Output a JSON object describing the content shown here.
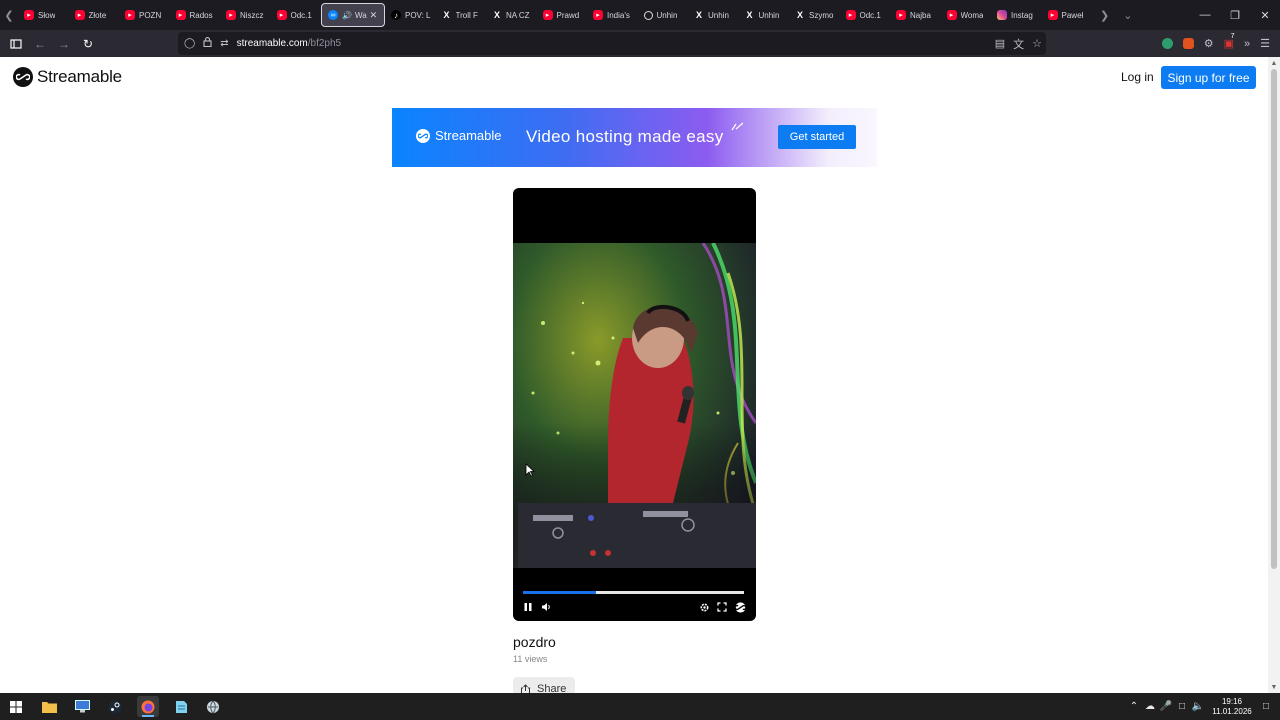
{
  "browser": {
    "tabs": [
      {
        "label": "Słow",
        "favicon": "youtube-icon"
      },
      {
        "label": "Złote",
        "favicon": "youtube-icon"
      },
      {
        "label": "POZN",
        "favicon": "youtube-icon"
      },
      {
        "label": "Rados",
        "favicon": "youtube-icon"
      },
      {
        "label": "Niszcz",
        "favicon": "youtube-icon"
      },
      {
        "label": "Odc.1",
        "favicon": "youtube-icon"
      },
      {
        "label": "Wa",
        "favicon": "streamable-icon",
        "active": true
      },
      {
        "label": "POV: L",
        "favicon": "tiktok-icon"
      },
      {
        "label": "Troll F",
        "favicon": "x-icon"
      },
      {
        "label": "NA CZ",
        "favicon": "x-icon"
      },
      {
        "label": "Prawd",
        "favicon": "youtube-icon"
      },
      {
        "label": "India's",
        "favicon": "youtube-icon"
      },
      {
        "label": "Unhin",
        "favicon": "threads-icon"
      },
      {
        "label": "Unhin",
        "favicon": "x-icon"
      },
      {
        "label": "Unhin",
        "favicon": "x-icon"
      },
      {
        "label": "Szymo",
        "favicon": "x-icon"
      },
      {
        "label": "Odc.1",
        "favicon": "youtube-icon"
      },
      {
        "label": "Najba",
        "favicon": "youtube-icon"
      },
      {
        "label": "Woma",
        "favicon": "youtube-icon"
      },
      {
        "label": "Instag",
        "favicon": "instagram-icon"
      },
      {
        "label": "Paweł",
        "favicon": "youtube-icon"
      }
    ],
    "url_host": "streamable.com",
    "url_path": "/bf2ph5",
    "extension_badge": "7"
  },
  "site": {
    "logo_text": "Streamable",
    "login_label": "Log in",
    "signup_label": "Sign up for free"
  },
  "banner": {
    "logo_text": "Streamable",
    "tagline": "Video hosting made easy",
    "cta_label": "Get started"
  },
  "player": {
    "progress": 0.33,
    "state": "playing"
  },
  "video": {
    "title": "pozdro",
    "views": "11 views",
    "share_label": "Share"
  },
  "taskbar": {
    "time": "19:16",
    "date": "11.01.2026"
  },
  "colors": {
    "brand_blue": "#0d7cf2",
    "progress_blue": "#1b6fe8",
    "youtube_red": "#ff0033"
  }
}
